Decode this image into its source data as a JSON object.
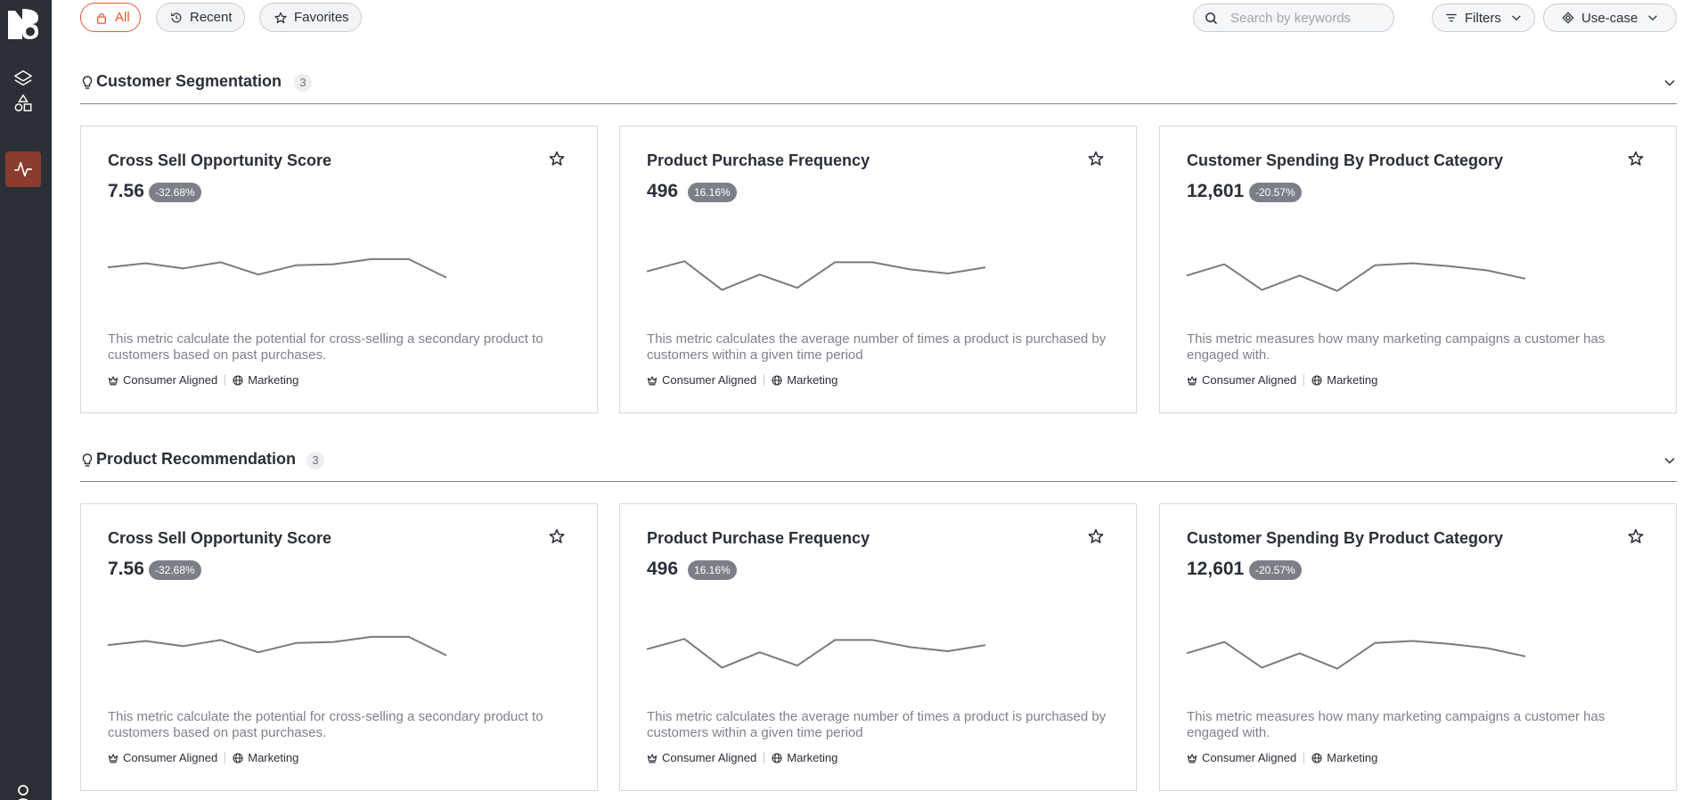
{
  "sidebar": {
    "logo_icon": "brand-logo-icon",
    "items": [
      {
        "name": "layers-icon",
        "active": false
      },
      {
        "name": "shapes-icon",
        "active": false
      },
      {
        "name": "activity-icon",
        "active": true
      }
    ],
    "user_icon": "user-icon"
  },
  "toolbar": {
    "tabs": [
      {
        "label": "All",
        "icon": "lock-icon",
        "active": true
      },
      {
        "label": "Recent",
        "icon": "history-icon",
        "active": false
      },
      {
        "label": "Favorites",
        "icon": "star-icon",
        "active": false
      }
    ],
    "search": {
      "placeholder": "Search by keywords",
      "value": ""
    },
    "filters_label": "Filters",
    "usecase_label": "Use-case"
  },
  "colors": {
    "accent": "#e35a2f",
    "sidebar": "#2b2f36",
    "sidebar_active": "#8a3d2c",
    "delta_badge": "#7c7f86"
  },
  "sections": [
    {
      "title": "Customer Segmentation",
      "count": "3",
      "cards": [
        {
          "title": "Cross Sell Opportunity Score",
          "value": "7.56",
          "delta": "-32.68%",
          "trend": [
            4.6,
            5.0,
            4.5,
            5.1,
            3.9,
            4.8,
            4.9,
            5.4,
            5.4,
            3.6
          ],
          "description": "This metric calculate the potential for cross-selling a secondary product to customers based on past purchases.",
          "tags": [
            "Consumer Aligned",
            "Marketing"
          ]
        },
        {
          "title": "Product Purchase Frequency",
          "value": "496",
          "delta": "16.16%",
          "trend": [
            4.2,
            5.2,
            2.4,
            3.9,
            2.6,
            5.1,
            5.1,
            4.4,
            4.0,
            4.6
          ],
          "description": "This metric calculates the average number of times a product is purchased by customers within a given time period",
          "tags": [
            "Consumer Aligned",
            "Marketing"
          ]
        },
        {
          "title": "Customer Spending By Product Category",
          "value": "12,601",
          "delta": "-20.57%",
          "trend": [
            3.8,
            4.9,
            2.4,
            3.8,
            2.3,
            4.8,
            5.0,
            4.7,
            4.3,
            3.5
          ],
          "description": "This metric measures how many marketing campaigns a customer has engaged with.",
          "tags": [
            "Consumer Aligned",
            "Marketing"
          ]
        }
      ]
    },
    {
      "title": "Product Recommendation",
      "count": "3",
      "cards": [
        {
          "title": "Cross Sell Opportunity Score",
          "value": "7.56",
          "delta": "-32.68%",
          "trend": [
            4.6,
            5.0,
            4.5,
            5.1,
            3.9,
            4.8,
            4.9,
            5.4,
            5.4,
            3.6
          ],
          "description": "This metric calculate the potential for cross-selling a secondary product to customers based on past purchases.",
          "tags": [
            "Consumer Aligned",
            "Marketing"
          ]
        },
        {
          "title": "Product Purchase Frequency",
          "value": "496",
          "delta": "16.16%",
          "trend": [
            4.2,
            5.2,
            2.4,
            3.9,
            2.6,
            5.1,
            5.1,
            4.4,
            4.0,
            4.6
          ],
          "description": "This metric calculates the average number of times a product is purchased by customers within a given time period",
          "tags": [
            "Consumer Aligned",
            "Marketing"
          ]
        },
        {
          "title": "Customer Spending By Product Category",
          "value": "12,601",
          "delta": "-20.57%",
          "trend": [
            3.8,
            4.9,
            2.4,
            3.8,
            2.3,
            4.8,
            5.0,
            4.7,
            4.3,
            3.5
          ],
          "description": "This metric measures how many marketing campaigns a customer has engaged with.",
          "tags": [
            "Consumer Aligned",
            "Marketing"
          ]
        }
      ]
    }
  ]
}
